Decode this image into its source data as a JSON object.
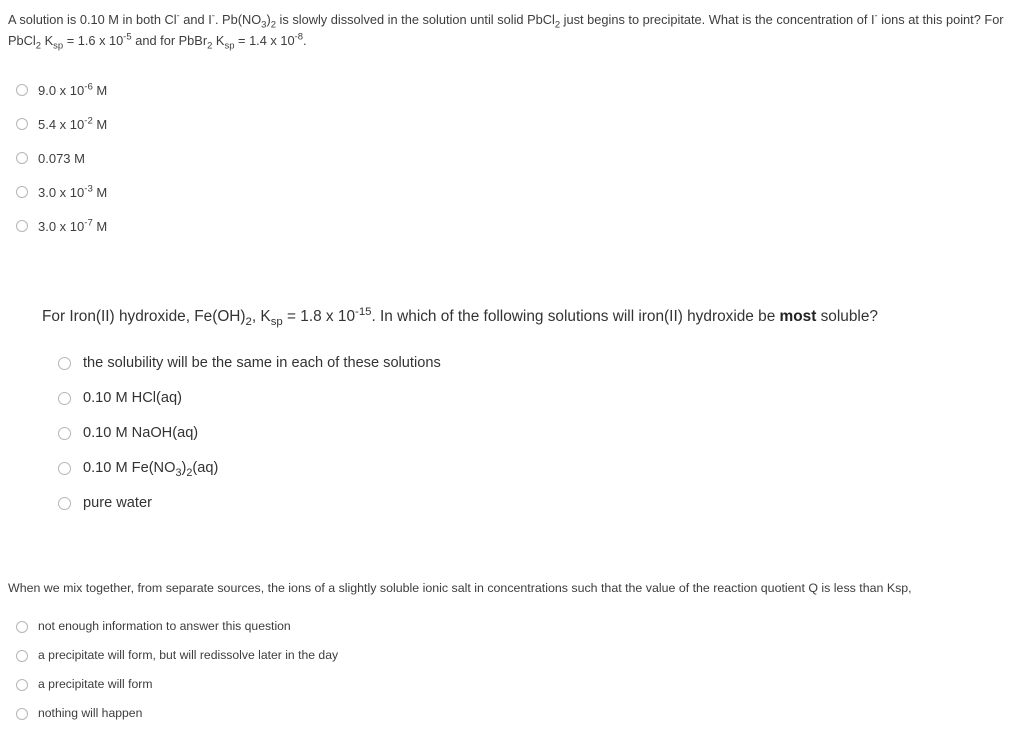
{
  "questions": [
    {
      "id": "q1",
      "prompt_plain": "A solution is 0.10 M in both Cl- and I-. Pb(NO3)2 is slowly dissolved in the solution until solid PbCl2 just begins to precipitate. What is the concentration of I- ions at this point? For PbCl2 Ksp = 1.6 x 10-5 and for PbBr2 Ksp = 1.4 x 10-8.",
      "options": [
        {
          "plain": "9.0 x 10-6 M",
          "mantissa": "9.0 x 10",
          "exponent": "-6",
          "unit": " M"
        },
        {
          "plain": "5.4 x 10-2 M",
          "mantissa": "5.4 x 10",
          "exponent": "-2",
          "unit": " M"
        },
        {
          "plain": "0.073 M",
          "mantissa": "0.073 M",
          "exponent": "",
          "unit": ""
        },
        {
          "plain": "3.0 x 10-3 M",
          "mantissa": "3.0 x 10",
          "exponent": "-3",
          "unit": " M"
        },
        {
          "plain": "3.0 x 10-7 M",
          "mantissa": "3.0 x 10",
          "exponent": "-7",
          "unit": " M"
        }
      ]
    },
    {
      "id": "q2",
      "prompt_plain": "For Iron(II) hydroxide, Fe(OH)2, Ksp = 1.8 x 10-15. In which of the following solutions will iron(II) hydroxide be most soluble?",
      "emphasis_word": "most",
      "options": [
        {
          "plain": "the solubility will be the same in each of these solutions"
        },
        {
          "plain": "0.10 M HCl(aq)"
        },
        {
          "plain": "0.10 M NaOH(aq)"
        },
        {
          "plain": "0.10 M Fe(NO3)2(aq)"
        },
        {
          "plain": "pure water"
        }
      ]
    },
    {
      "id": "q3",
      "prompt_plain": "When we mix together, from separate sources, the ions of a slightly soluble ionic salt in concentrations such that the value of the reaction quotient Q is less than Ksp,",
      "options": [
        {
          "plain": "not enough information to answer this question"
        },
        {
          "plain": "a precipitate will form, but will redissolve later in the day"
        },
        {
          "plain": "a precipitate will form"
        },
        {
          "plain": "nothing will happen"
        }
      ]
    }
  ],
  "colors": {
    "background": "#ffffff",
    "text": "#3d3d3d",
    "radio_border": "#b6b6b6"
  }
}
